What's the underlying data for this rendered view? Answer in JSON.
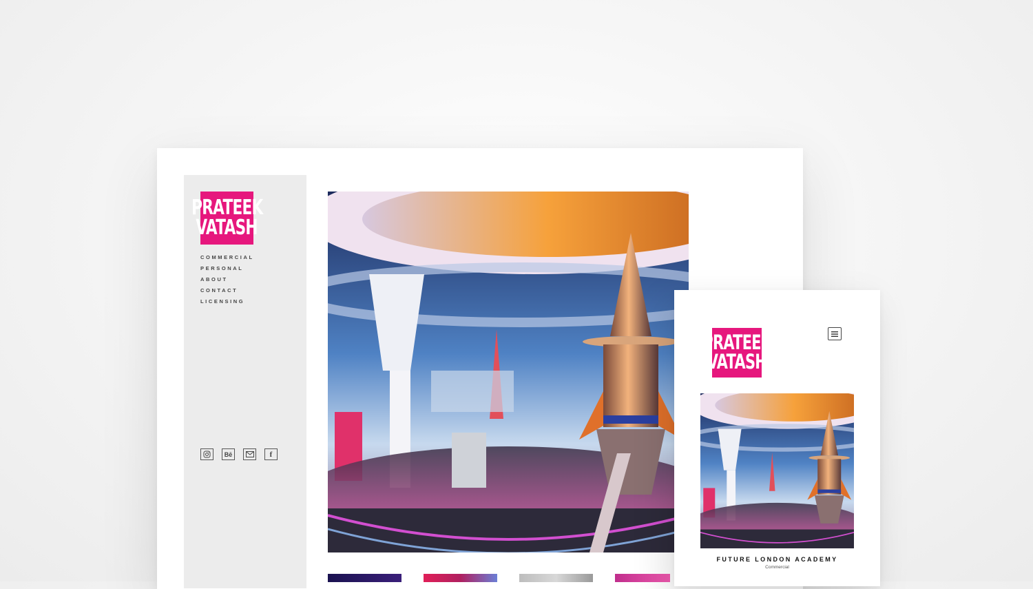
{
  "brand": {
    "line1": "PRATEEK",
    "line2": "VATASH",
    "color": "#e6177d"
  },
  "desktop": {
    "nav": [
      {
        "label": "COMMERCIAL"
      },
      {
        "label": "PERSONAL"
      },
      {
        "label": "ABOUT"
      },
      {
        "label": "CONTACT"
      },
      {
        "label": "LICENSING"
      }
    ],
    "social": [
      {
        "icon": "instagram-icon",
        "glyph": "◎"
      },
      {
        "icon": "behance-icon",
        "glyph": "Bē"
      },
      {
        "icon": "mail-icon",
        "glyph": "✉"
      },
      {
        "icon": "facebook-icon",
        "glyph": "f"
      }
    ],
    "hero_image": "retro-futuristic rocket station artwork"
  },
  "mobile": {
    "title": "FUTURE LONDON ACADEMY",
    "subtitle": "Commercial"
  }
}
